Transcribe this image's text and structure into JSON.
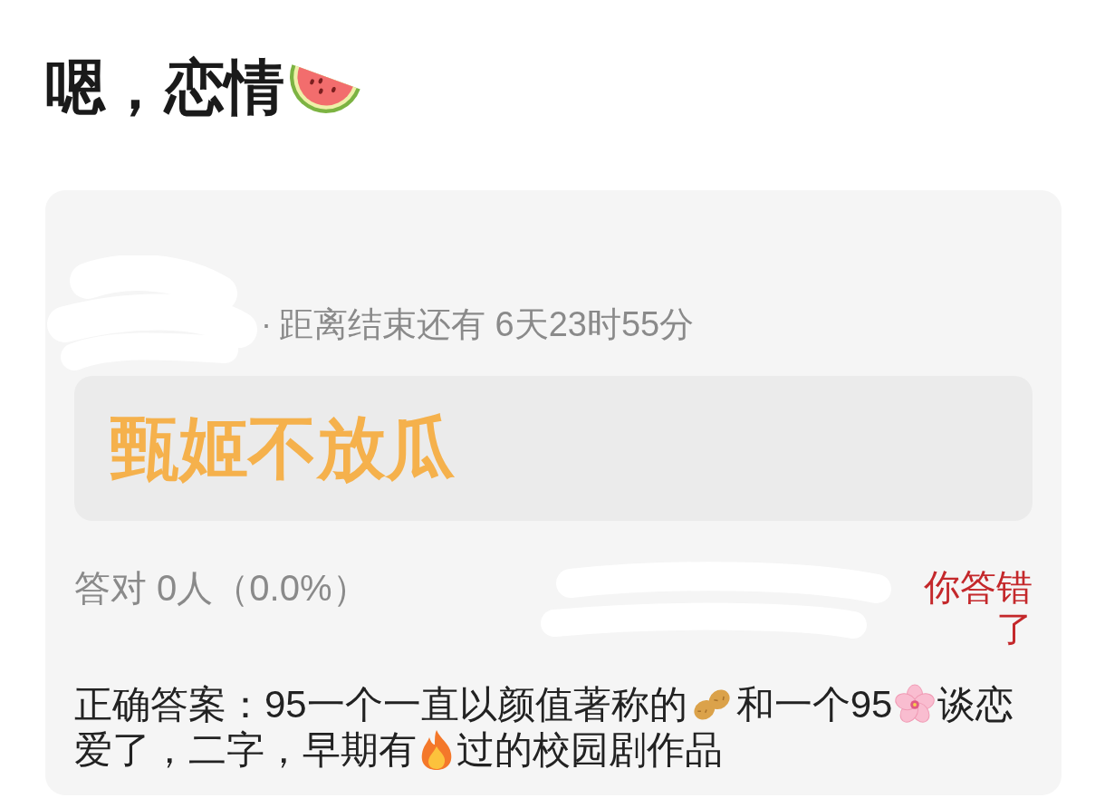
{
  "title": "嗯，恋情",
  "card": {
    "separator": "·",
    "countdown": "距离结束还有 6天23时55分",
    "option": "甄姬不放瓜",
    "stats": "答对 0人（0.0%）",
    "result": {
      "text": "你答错了",
      "correct": false
    },
    "answer_lines": [
      [
        {
          "kind": "text",
          "text": "正确答案：95一个一直以颜值著称的"
        },
        {
          "kind": "peanut"
        },
        {
          "kind": "text",
          "text": "和一个95"
        },
        {
          "kind": "blossom"
        },
        {
          "kind": "text",
          "text": "谈恋"
        }
      ],
      [
        {
          "kind": "text",
          "text": "爱了，二字，早期有"
        },
        {
          "kind": "fire"
        },
        {
          "kind": "text",
          "text": "过的校园剧作品"
        }
      ]
    ]
  }
}
